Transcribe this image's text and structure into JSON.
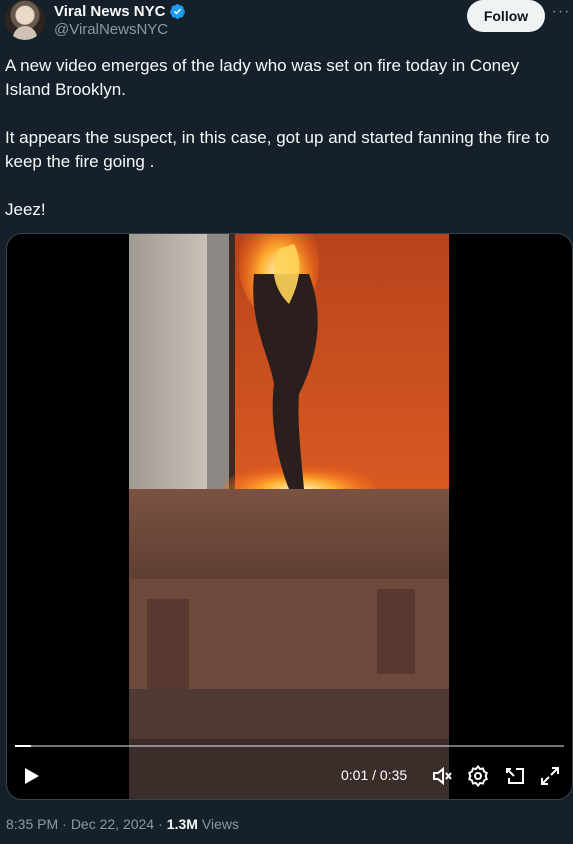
{
  "author": {
    "display_name": "Viral News NYC",
    "handle": "@ViralNewsNYC",
    "verified": true
  },
  "actions": {
    "follow_label": "Follow",
    "more_label": "···"
  },
  "tweet": {
    "text": "A new video emerges of the lady who was set on fire today in Coney Island Brooklyn.\n\nIt appears the suspect, in this case, got up and started fanning the fire to keep the fire going .\n\nJeez!"
  },
  "video": {
    "current_time": "0:01",
    "duration": "0:35",
    "time_display": "0:01 / 0:35",
    "progress_fraction": 0.029
  },
  "meta": {
    "time": "8:35 PM",
    "separator": "·",
    "date": "Dec 22, 2024",
    "views_count": "1.3M",
    "views_label": "Views"
  },
  "colors": {
    "background": "#15202b",
    "verified_badge": "#1d9bf0",
    "secondary_text": "#8b98a5"
  }
}
